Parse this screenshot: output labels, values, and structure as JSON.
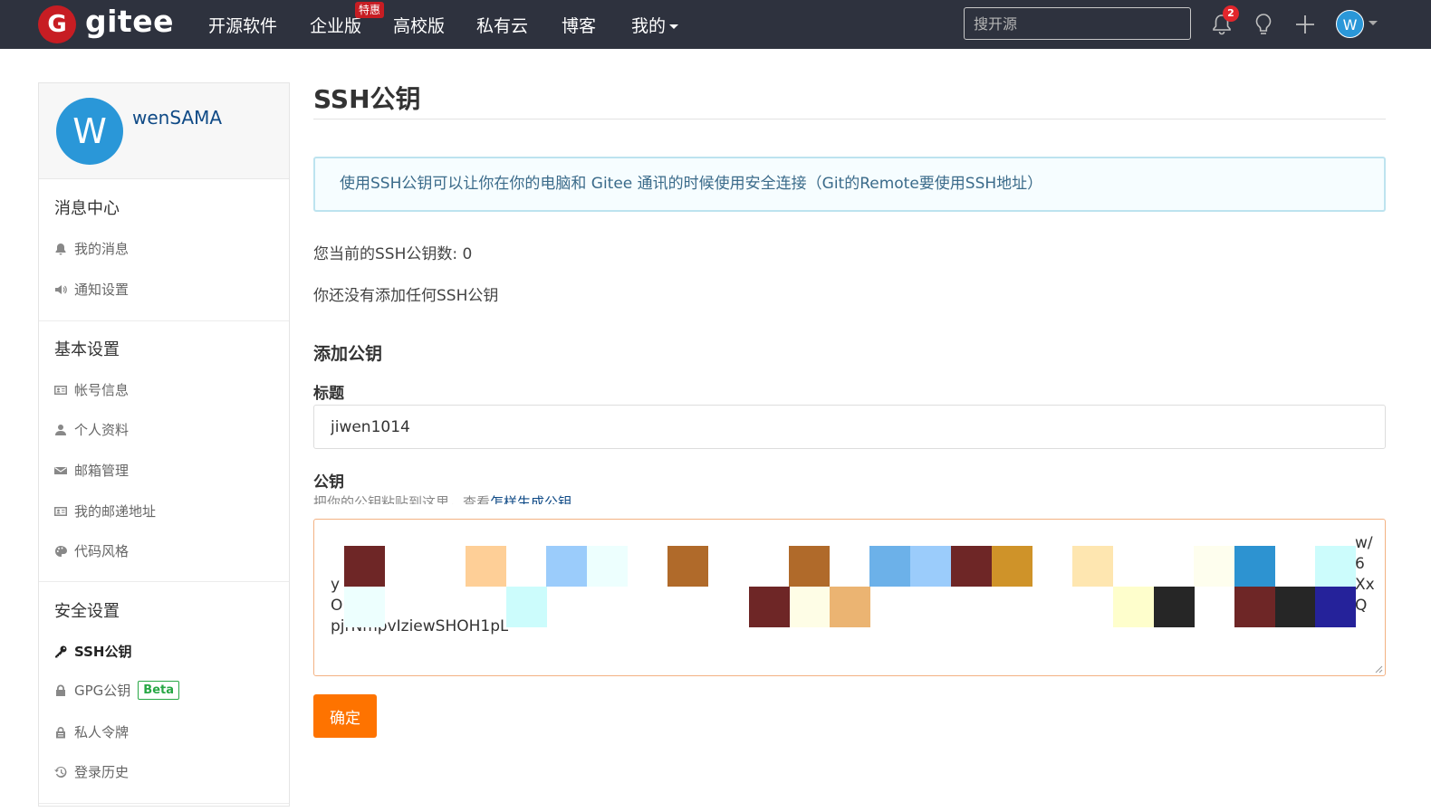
{
  "navbar": {
    "brand": "gitee",
    "logo_letter": "G",
    "items": [
      "开源软件",
      "企业版",
      "高校版",
      "私有云",
      "博客",
      "我的"
    ],
    "enterprise_badge": "特惠",
    "search_placeholder": "搜开源",
    "notification_count": "2",
    "avatar_letter": "W",
    "bg_color": "#2e323e",
    "brand_color": "#c71d23"
  },
  "sidebar": {
    "avatar_letter": "W",
    "username": "wenSAMA",
    "sections": [
      {
        "title": "消息中心",
        "items": [
          "我的消息",
          "通知设置"
        ]
      },
      {
        "title": "基本设置",
        "items": [
          "帐号信息",
          "个人资料",
          "邮箱管理",
          "我的邮递地址",
          "代码风格"
        ]
      },
      {
        "title": "安全设置",
        "items": [
          "SSH公钥",
          "GPG公钥",
          "私人令牌",
          "登录历史"
        ]
      }
    ],
    "gpg_badge": "Beta",
    "active_item": "SSH公钥"
  },
  "main": {
    "title": "SSH公钥",
    "info": "使用SSH公钥可以让你在你的电脑和 Gitee 通讯的时候使用安全连接（Git的Remote要使用SSH地址）",
    "key_count_text": "您当前的SSH公钥数: 0",
    "no_key_text": "你还没有添加任何SSH公钥",
    "add_heading": "添加公钥",
    "title_label": "标题",
    "title_value": "jiwen1014",
    "key_label": "公钥",
    "key_hint_prefix": "把你的公钥粘贴到这里，查看",
    "key_hint_link": "怎样生成公钥",
    "key_fragments": {
      "line1_right": "w/",
      "line2_right": "6",
      "line3_left": "y",
      "line3_right": "Xx",
      "line4_left": "O",
      "line4_right": "Q",
      "line5_left": "pjrNmpvIziewSHOH1pL"
    },
    "submit_label": "确定",
    "submit_color": "#fe7300"
  }
}
